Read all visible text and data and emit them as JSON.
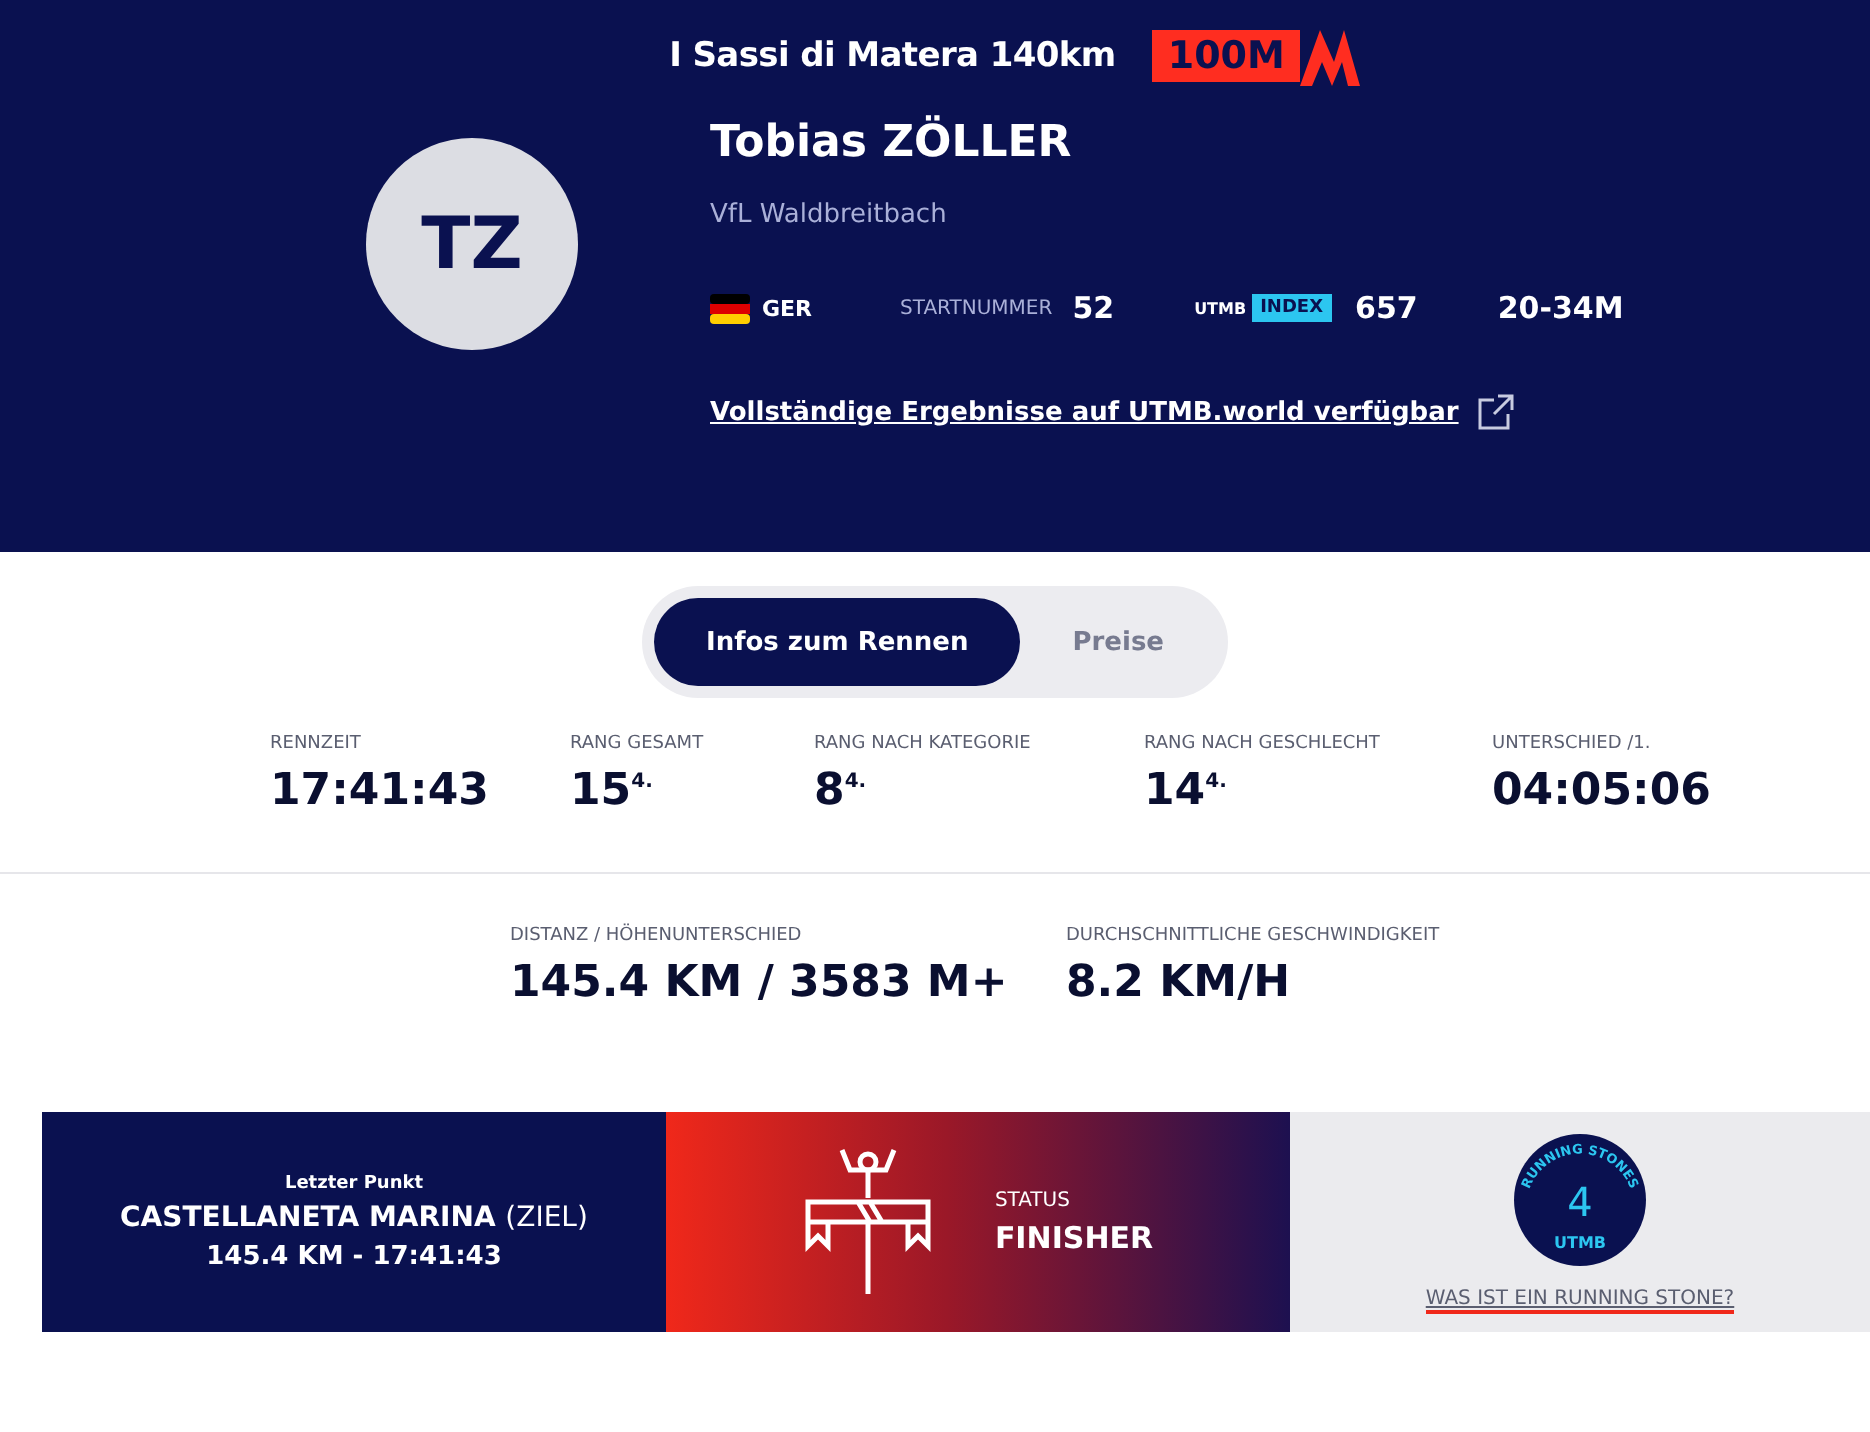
{
  "race": {
    "title": "I Sassi di Matera 140km",
    "badge": "100M"
  },
  "runner": {
    "initials": "TZ",
    "name": "Tobias ZÖLLER",
    "club": "VfL Waldbreitbach",
    "country": "GER",
    "bib_label": "STARTNUMMER",
    "bib": "52",
    "index_brand": "UTMB",
    "index_label": "INDEX",
    "index": "657",
    "category": "20-34M",
    "link": "Vollständige Ergebnisse auf UTMB.world verfügbar"
  },
  "tabs": [
    {
      "label": "Infos zum Rennen",
      "selected": true
    },
    {
      "label": "Preise",
      "selected": false
    }
  ],
  "stats": [
    {
      "label": "RENNZEIT",
      "value": "17:41:43"
    },
    {
      "label": "RANG GESAMT",
      "value": "15",
      "sup": "4."
    },
    {
      "label": "RANG NACH KATEGORIE",
      "value": "8",
      "sup": "4."
    },
    {
      "label": "RANG NACH GESCHLECHT",
      "value": "14",
      "sup": "4."
    },
    {
      "label": "UNTERSCHIED /1.",
      "value": "04:05:06"
    }
  ],
  "stats2": [
    {
      "label": "DISTANZ / HÖHENUNTERSCHIED",
      "value": "145.4 KM / 3583 M+"
    },
    {
      "label": "DURCHSCHNITTLICHE GESCHWINDIGKEIT",
      "value": "8.2 KM/H"
    }
  ],
  "last_point": {
    "label": "Letzter Punkt",
    "place": "CASTELLANETA MARINA",
    "note": "(ZIEL)",
    "detail": "145.4 KM - 17:41:43"
  },
  "status": {
    "label": "STATUS",
    "value": "FINISHER"
  },
  "stones": {
    "ring": "RUNNING STONES",
    "count": "4",
    "brand": "UTMB",
    "link": "WAS IST EIN RUNNING STONE?"
  }
}
